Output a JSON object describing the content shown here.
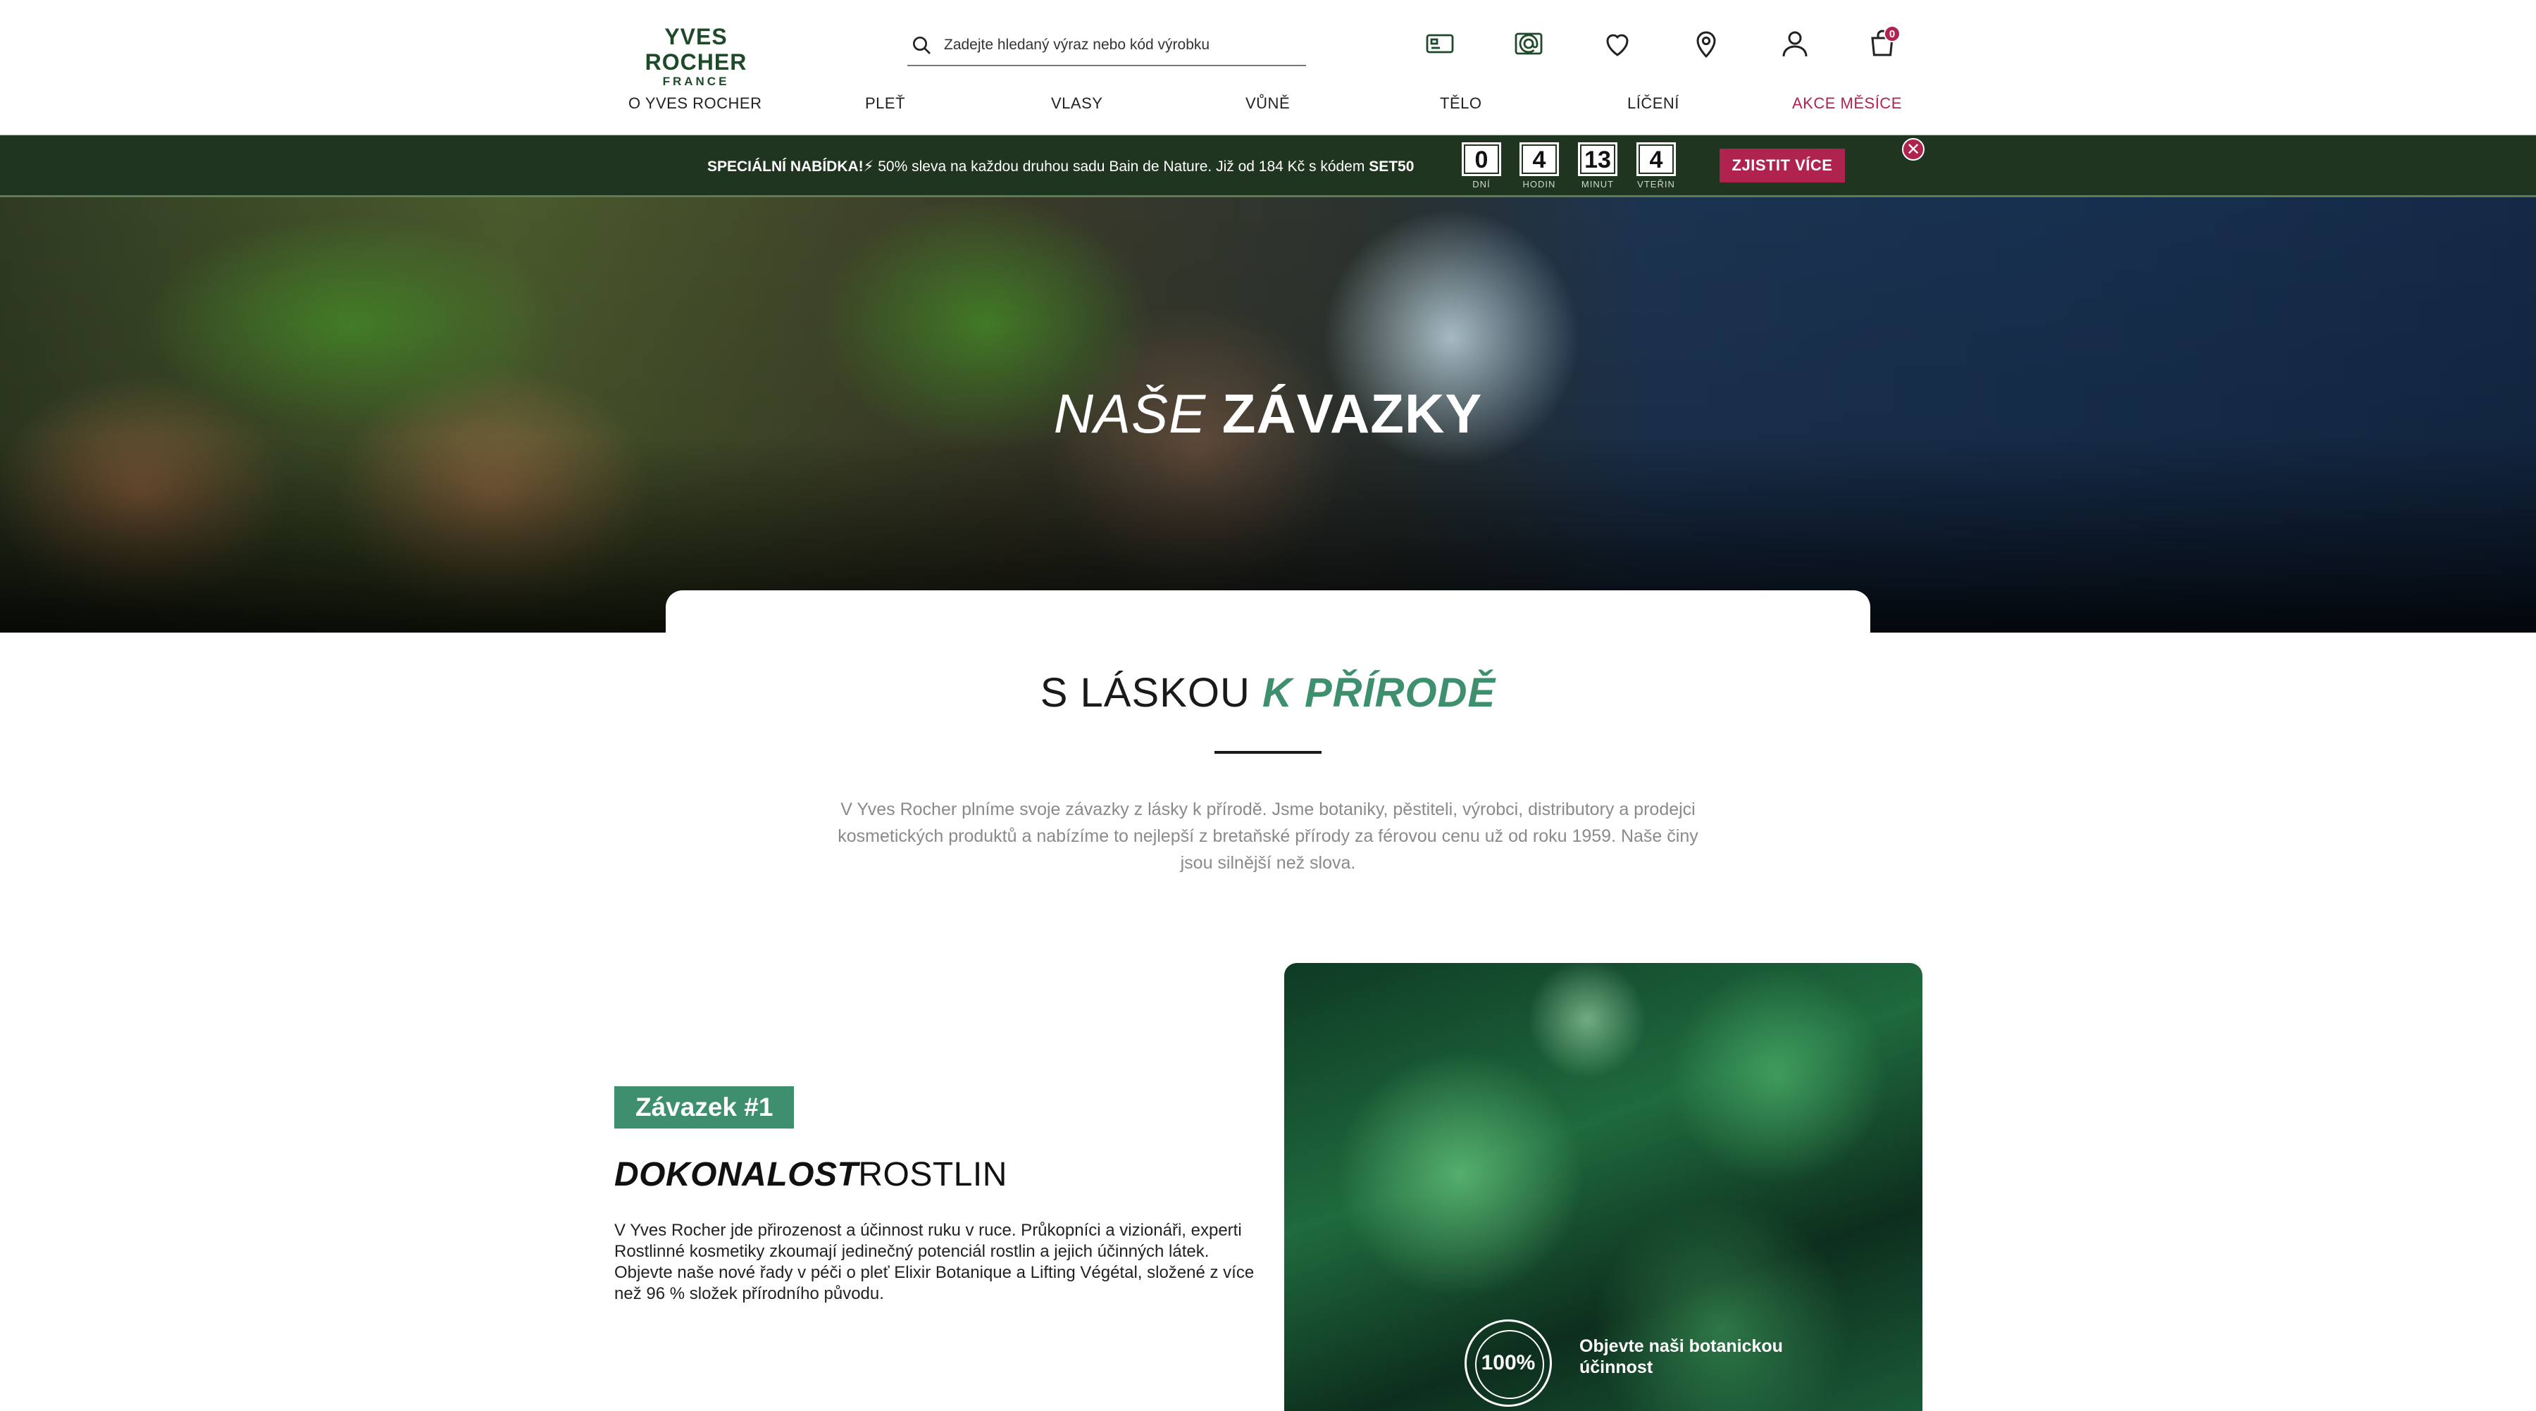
{
  "header": {
    "logo_main": "YVES ROCHER",
    "logo_sub": "FRANCE",
    "search_placeholder": "Zadejte hledaný výraz nebo kód výrobku",
    "cart_count": "0",
    "icons": [
      "gift-card-icon",
      "email-card-icon",
      "heart-icon",
      "location-pin-icon",
      "user-icon",
      "cart-icon"
    ]
  },
  "nav": {
    "items": [
      "O YVES ROCHER",
      "PLEŤ",
      "VLASY",
      "VŮNĚ",
      "TĚLO",
      "LÍČENÍ",
      "AKCE MĚSÍCE"
    ]
  },
  "promo": {
    "label": "SPECIÁLNÍ NABÍDKA!",
    "emoji": "⚡",
    "text": " 50% sleva na každou druhou sadu Bain de Nature. Již od 184 Kč s kódem ",
    "code": "SET50",
    "countdown": [
      {
        "value": "0",
        "unit": "DNÍ"
      },
      {
        "value": "4",
        "unit": "HODIN"
      },
      {
        "value": "13",
        "unit": "MINUT"
      },
      {
        "value": "4",
        "unit": "VTEŘIN"
      }
    ],
    "cta": "ZJISTIT VÍCE",
    "close": "✕"
  },
  "hero": {
    "title_light": "NAŠE",
    "title_bold": "ZÁVAZKY"
  },
  "intro": {
    "title_plain": "S LÁSKOU",
    "title_accent": "K PŘÍRODĚ",
    "text": "V Yves Rocher plníme svoje závazky z lásky k přírodě. Jsme botaniky, pěstiteli, výrobci, distributory a prodejci kosmetických produktů a nabízíme to nejlepší z bretaňské přírody za férovou cenu už od roku 1959. Naše činy jsou silnější než slova."
  },
  "commitment": {
    "badge": "Závazek #1",
    "title_bold": "DOKONALOST",
    "title_plain": "ROSTLIN",
    "text": "V Yves Rocher jde přirozenost a účinnost ruku v ruce. Průkopníci a vizionáři, experti Rostlinné kosmetiky zkoumají jedinečný potenciál rostlin a jejich účinných látek. Objevte naše nové řady v péči o pleť Elixir Botanique a Lifting Végétal, složené z více než 96 % složek přírodního původu.",
    "media_logo": "100%",
    "media_cta": "Objevte naši botanickou účinnost"
  },
  "colors": {
    "brand_green": "#1f4a2a",
    "accent_green": "#3d8f6e",
    "promo_bg": "#20351f",
    "accent_pink": "#b0234f"
  }
}
